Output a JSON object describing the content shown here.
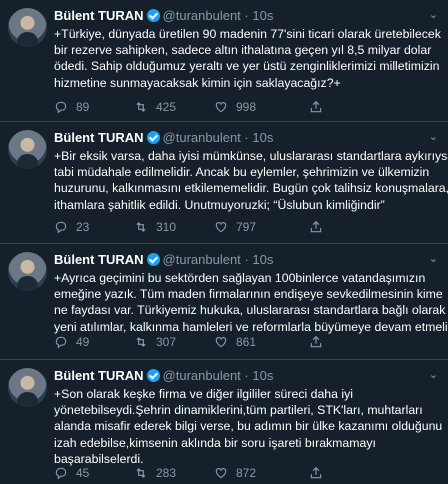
{
  "tweets": [
    {
      "name": "Bülent TURAN",
      "handle": "@turanbulent",
      "time": "10s",
      "lines": [
        "+Türkiye, dünyada üretilen 90 madenin 77'sini ticari olarak üretebilecek",
        "bir rezerve sahipken, sadece altın ithalatına geçen yıl 8,5 milyar dolar",
        "ödedi. Sahip olduğumuz yeraltı ve yer üstü zenginliklerimizi milletimizin",
        "hizmetine sunmayacaksak kimin için saklayacağız?+"
      ],
      "replies": "89",
      "retweets": "425",
      "likes": "998"
    },
    {
      "name": "Bülent TURAN",
      "handle": "@turanbulent",
      "time": "10s",
      "lines": [
        "+Bir eksik varsa, daha iyisi mümkünse, uluslararası standartlara aykırıysa",
        "tabi müdahale edilmelidir. Ancak bu eylemler, şehrimizin ve ülkemizin",
        "huzurunu, kalkınmasını etkilememelidir. Bugün çok talihsiz konuşmalara,",
        "ithamlara şahitlik edildi. Unutmuyoruzki; “Üslubun kimliğindir”"
      ],
      "replies": "23",
      "retweets": "310",
      "likes": "797"
    },
    {
      "name": "Bülent TURAN",
      "handle": "@turanbulent",
      "time": "10s",
      "lines": [
        "+Ayrıca geçimini bu sektörden sağlayan 100binlerce  vatandaşımızın",
        "emeğine yazık. Tüm maden firmalarının endişeye sevkedilmesinin kime",
        "ne faydası var. Türkiyemiz hukuka, uluslararası standartlara bağlı olarak",
        "yeni atılımlar, kalkınma hamleleri ve reformlarla büyümeye devam etmeli"
      ],
      "replies": "49",
      "retweets": "307",
      "likes": "861"
    },
    {
      "name": "Bülent TURAN",
      "handle": "@turanbulent",
      "time": "10s",
      "lines": [
        "+Son olarak keşke firma ve diğer ilgililer süreci daha iyi",
        "yönetebilseydi.Şehrin dinamiklerini,tüm partileri, STK'ları, muhtarları",
        "alanda misafir ederek bilgi verse, bu adımın bir ülke kazanımı olduğunu",
        "izah edebilse,kimsenin aklında bir soru işareti bırakmamayı",
        "başarabilselerdi."
      ],
      "replies": "45",
      "retweets": "283",
      "likes": "872"
    }
  ],
  "icons": {
    "reply": "reply-icon",
    "retweet": "retweet-icon",
    "like": "heart-icon",
    "share": "share-icon",
    "caret": "chevron-down-icon",
    "verified": "verified-badge-icon"
  },
  "colors": {
    "background": "#15202b",
    "muted": "#8899a6",
    "verified": "#1da1f2",
    "divider": "#38444d"
  }
}
